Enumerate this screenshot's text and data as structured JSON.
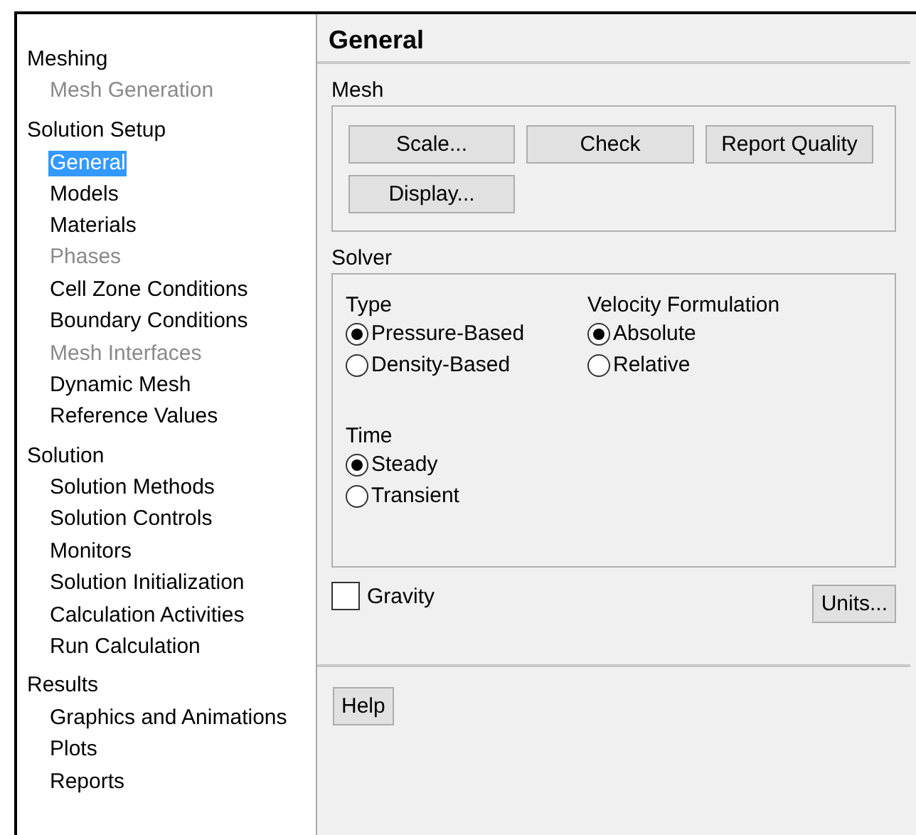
{
  "tree": [
    {
      "label": "Meshing",
      "children": [
        {
          "label": "Mesh Generation",
          "disabled": true,
          "selected": false
        }
      ]
    },
    {
      "label": "Solution Setup",
      "children": [
        {
          "label": "General",
          "disabled": false,
          "selected": true
        },
        {
          "label": "Models",
          "disabled": false,
          "selected": false
        },
        {
          "label": "Materials",
          "disabled": false,
          "selected": false
        },
        {
          "label": "Phases",
          "disabled": true,
          "selected": false
        },
        {
          "label": "Cell Zone Conditions",
          "disabled": false,
          "selected": false
        },
        {
          "label": "Boundary Conditions",
          "disabled": false,
          "selected": false
        },
        {
          "label": "Mesh Interfaces",
          "disabled": true,
          "selected": false
        },
        {
          "label": "Dynamic Mesh",
          "disabled": false,
          "selected": false
        },
        {
          "label": "Reference Values",
          "disabled": false,
          "selected": false
        }
      ]
    },
    {
      "label": "Solution",
      "children": [
        {
          "label": "Solution Methods",
          "disabled": false,
          "selected": false
        },
        {
          "label": "Solution Controls",
          "disabled": false,
          "selected": false
        },
        {
          "label": "Monitors",
          "disabled": false,
          "selected": false
        },
        {
          "label": "Solution Initialization",
          "disabled": false,
          "selected": false
        },
        {
          "label": "Calculation Activities",
          "disabled": false,
          "selected": false
        },
        {
          "label": "Run Calculation",
          "disabled": false,
          "selected": false
        }
      ]
    },
    {
      "label": "Results",
      "children": [
        {
          "label": "Graphics and Animations",
          "disabled": false,
          "selected": false
        },
        {
          "label": "Plots",
          "disabled": false,
          "selected": false
        },
        {
          "label": "Reports",
          "disabled": false,
          "selected": false
        }
      ]
    }
  ],
  "panel": {
    "title": "General",
    "mesh": {
      "label": "Mesh",
      "buttons": [
        "Scale...",
        "Check",
        "Report Quality",
        "Display..."
      ]
    },
    "solver": {
      "label": "Solver",
      "groups": [
        {
          "label": "Type",
          "options": [
            {
              "label": "Pressure-Based",
              "selected": true
            },
            {
              "label": "Density-Based",
              "selected": false
            }
          ]
        },
        {
          "label": "Velocity Formulation",
          "options": [
            {
              "label": "Absolute",
              "selected": true
            },
            {
              "label": "Relative",
              "selected": false
            }
          ]
        },
        {
          "label": "Time",
          "options": [
            {
              "label": "Steady",
              "selected": true
            },
            {
              "label": "Transient",
              "selected": false
            }
          ]
        }
      ]
    },
    "gravity": {
      "label": "Gravity",
      "checked": false
    },
    "units_button": "Units...",
    "help_button": "Help"
  }
}
